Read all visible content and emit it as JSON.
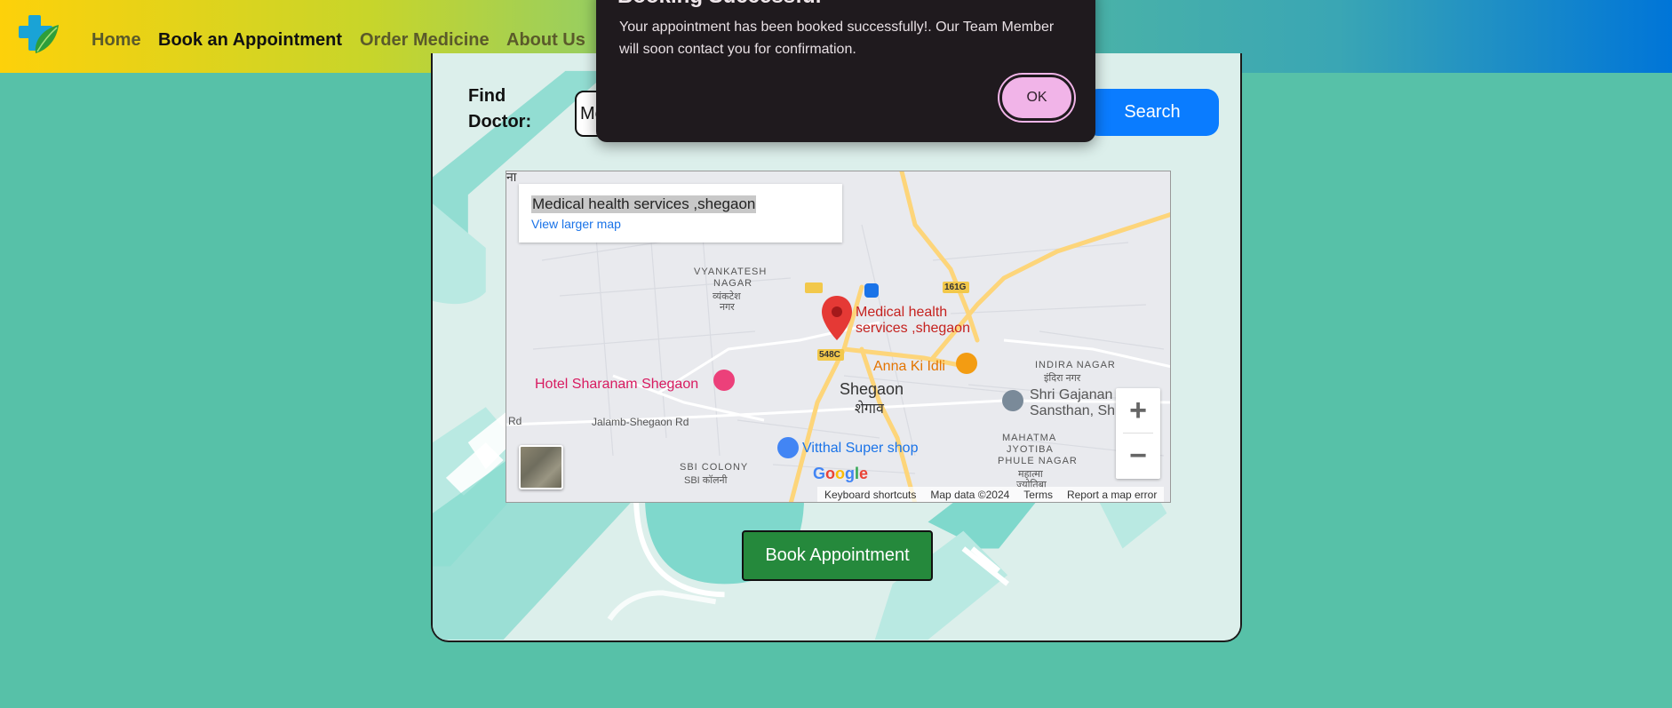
{
  "nav": {
    "items": [
      {
        "label": "Home"
      },
      {
        "label": "Book an Appointment"
      },
      {
        "label": "Order Medicine"
      },
      {
        "label": "About Us"
      }
    ]
  },
  "finder": {
    "label": "Find Doctor:",
    "input_value": "Me",
    "search_label": "Search"
  },
  "map": {
    "place_title": "Medical health services ,shegaon",
    "view_larger": "View larger map",
    "labels": {
      "vyankatesh": "VYANKATESH",
      "nagar1": "NAGAR",
      "vyankatesh_dev": "व्यंकटेश",
      "nagar_dev": "नगर",
      "marker": "Medical health",
      "marker2": "services ,shegaon",
      "hotel": "Hotel Sharanam Shegaon",
      "anna": "Anna Ki Idli",
      "shegaon": "Shegaon",
      "shegaon_dev": "शेगाव",
      "indira": "INDIRA NAGAR",
      "indira_dev": "इंदिरा नगर",
      "gajanan": "Shri Gajanan",
      "sansthan": "Sansthan, Sh",
      "road": "Jalamb-Shegaon Rd",
      "rd": "Rd",
      "vitthal": "Vitthal Super shop",
      "sbi": "SBI COLONY",
      "sbi_dev": "SBI कॉलनी",
      "mahatma": "MAHATMA",
      "jyotiba": "JYOTIBA",
      "phule": "PHULE NAGAR",
      "mahatma_dev": "महात्मा",
      "jyotiba_dev": "ज्योतिबा",
      "r161": "161G",
      "r548": "548C",
      "na": "ना"
    },
    "google": "Google",
    "footer": {
      "shortcuts": "Keyboard shortcuts",
      "mapdata": "Map data ©2024",
      "terms": "Terms",
      "report": "Report a map error"
    }
  },
  "book_label": "Book Appointment",
  "dialog": {
    "title": "Booking Successful",
    "message": "Your appointment has been booked successfully!. Our Team Member will soon contact you for confirmation.",
    "ok_label": "OK"
  },
  "colors": {
    "page_bg": "#57c1a8",
    "search": "#0a7cff",
    "book": "#25893c",
    "ok": "#f1b4e8"
  }
}
